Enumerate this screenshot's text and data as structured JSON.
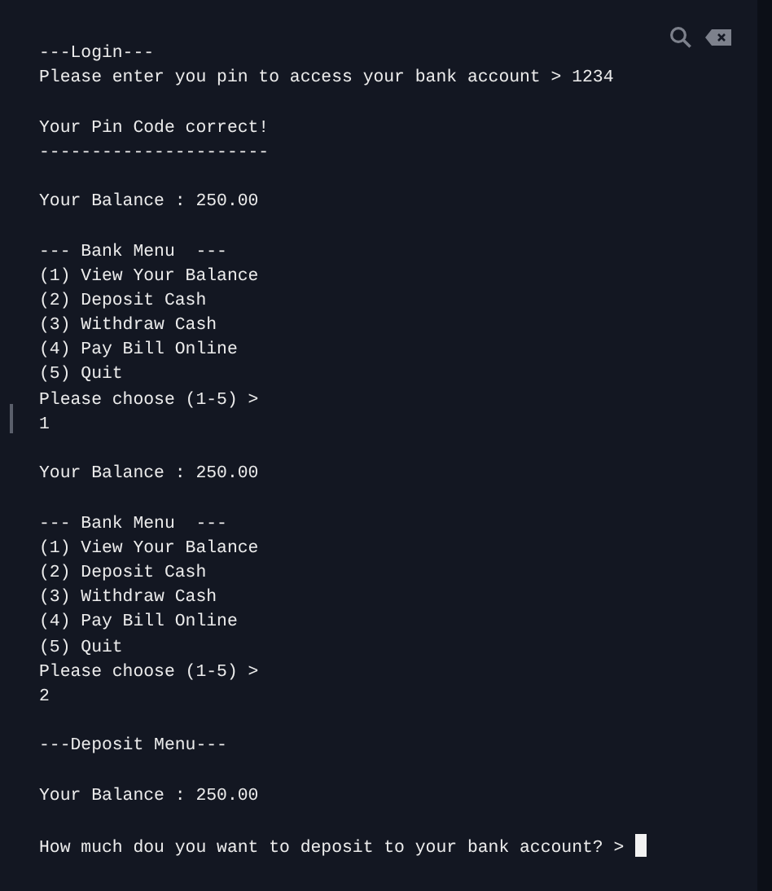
{
  "terminal": {
    "lines": [
      {
        "kind": "text",
        "text": "---Login---"
      },
      {
        "kind": "text",
        "text": "Please enter you pin to access your bank account > 1234"
      },
      {
        "kind": "blank"
      },
      {
        "kind": "text",
        "text": "Your Pin Code correct!"
      },
      {
        "kind": "text",
        "text": "----------------------"
      },
      {
        "kind": "blank"
      },
      {
        "kind": "text",
        "text": "Your Balance : 250.00"
      },
      {
        "kind": "blank"
      },
      {
        "kind": "text",
        "text": "--- Bank Menu  ---"
      },
      {
        "kind": "text",
        "text": "(1) View Your Balance"
      },
      {
        "kind": "text",
        "text": "(2) Deposit Cash"
      },
      {
        "kind": "text",
        "text": "(3) Withdraw Cash"
      },
      {
        "kind": "text",
        "text": "(4) Pay Bill Online"
      },
      {
        "kind": "text",
        "text": "(5) Quit"
      },
      {
        "kind": "text",
        "text": "Please choose (1-5) >"
      },
      {
        "kind": "text",
        "text": "1"
      },
      {
        "kind": "blank"
      },
      {
        "kind": "text",
        "text": "Your Balance : 250.00"
      },
      {
        "kind": "blank"
      },
      {
        "kind": "text",
        "text": "--- Bank Menu  ---"
      },
      {
        "kind": "text",
        "text": "(1) View Your Balance"
      },
      {
        "kind": "text",
        "text": "(2) Deposit Cash"
      },
      {
        "kind": "text",
        "text": "(3) Withdraw Cash"
      },
      {
        "kind": "text",
        "text": "(4) Pay Bill Online"
      },
      {
        "kind": "text",
        "text": "(5) Quit"
      },
      {
        "kind": "text",
        "text": "Please choose (1-5) >"
      },
      {
        "kind": "text",
        "text": "2"
      },
      {
        "kind": "blank"
      },
      {
        "kind": "text",
        "text": "---Deposit Menu---"
      },
      {
        "kind": "blank"
      },
      {
        "kind": "text",
        "text": "Your Balance : 250.00"
      },
      {
        "kind": "blank"
      },
      {
        "kind": "prompt",
        "text": "How much dou you want to deposit to your bank account? > "
      }
    ]
  }
}
